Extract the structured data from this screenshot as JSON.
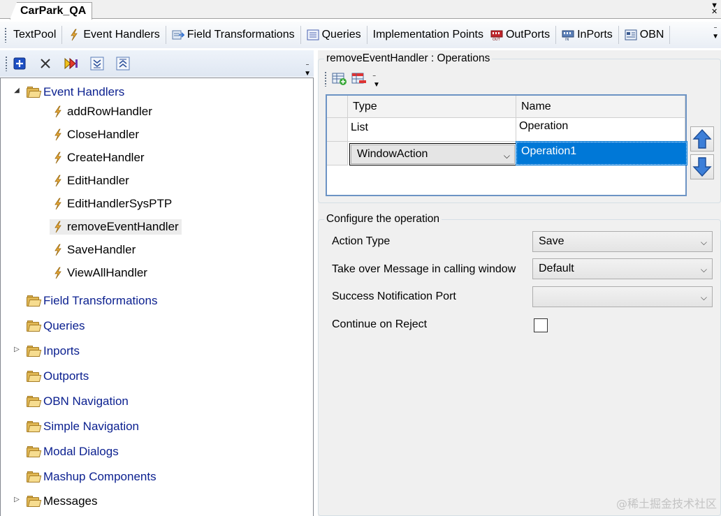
{
  "document_tab": {
    "title": "CarPark_QA"
  },
  "main_toolbar": {
    "items": [
      {
        "label": "TextPool",
        "icon": "none"
      },
      {
        "label": "Event Handlers",
        "icon": "lightning-icon"
      },
      {
        "label": "Field Transformations",
        "icon": "field-transform-icon"
      },
      {
        "label": "Queries",
        "icon": "queries-icon"
      },
      {
        "label": "Implementation Points",
        "icon": "none"
      },
      {
        "label": "OutPorts",
        "icon": "outport-icon"
      },
      {
        "label": "InPorts",
        "icon": "inport-icon"
      },
      {
        "label": "OBN",
        "icon": "obn-icon"
      }
    ]
  },
  "left_toolbar": {
    "buttons": [
      "add-icon",
      "delete-icon",
      "run-icon",
      "expand-all-icon",
      "collapse-all-icon"
    ]
  },
  "tree": {
    "root": {
      "label": "Event Handlers",
      "expanded": true
    },
    "handlers": [
      "addRowHandler",
      "CloseHandler",
      "CreateHandler",
      "EditHandler",
      "EditHandlerSysPTP",
      "removeEventHandler",
      "SaveHandler",
      "ViewAllHandler"
    ],
    "selected_handler": "removeEventHandler",
    "folders": [
      {
        "label": "Field Transformations",
        "expander": ""
      },
      {
        "label": "Queries",
        "expander": ""
      },
      {
        "label": "Inports",
        "expander": "▷"
      },
      {
        "label": "Outports",
        "expander": ""
      },
      {
        "label": "OBN Navigation",
        "expander": ""
      },
      {
        "label": "Simple Navigation",
        "expander": ""
      },
      {
        "label": "Modal Dialogs",
        "expander": ""
      },
      {
        "label": "Mashup Components",
        "expander": ""
      },
      {
        "label": "Messages",
        "expander": "▷"
      }
    ]
  },
  "operations": {
    "title": "removeEventHandler : Operations",
    "columns": {
      "type": "Type",
      "name": "Name"
    },
    "rows": [
      {
        "type": "List",
        "name": "Operation"
      },
      {
        "type": "WindowAction",
        "name": "Operation1"
      }
    ]
  },
  "config": {
    "title": "Configure the operation",
    "action_type": {
      "label": "Action Type",
      "value": "Save"
    },
    "take_over": {
      "label": "Take over Message in calling window",
      "value": "Default"
    },
    "success_port": {
      "label": "Success Notification Port",
      "value": ""
    },
    "continue_on_reject": {
      "label": "Continue on Reject",
      "checked": false
    }
  },
  "watermark": "@稀土掘金技术社区",
  "colors": {
    "selection": "#0078d7",
    "tree_text": "#0a1f8f",
    "folder": "#e0b753"
  }
}
